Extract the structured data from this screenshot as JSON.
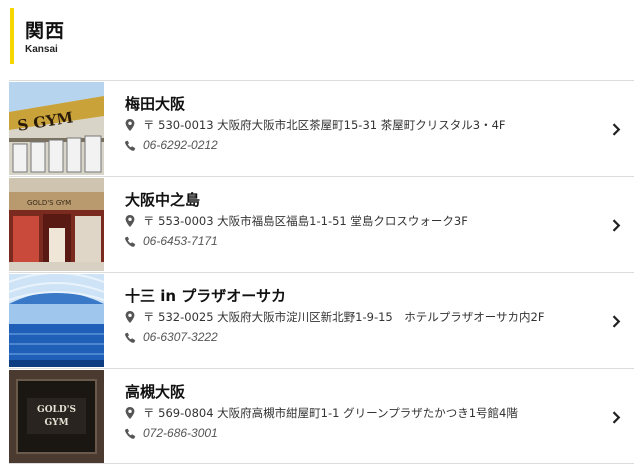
{
  "region": {
    "title": "関西",
    "subtitle": "Kansai",
    "accent_color": "#f5d800"
  },
  "icons": {
    "location": "location-pin-icon",
    "phone": "phone-icon",
    "chevron": "chevron-right-icon"
  },
  "gyms": [
    {
      "name": "梅田大阪",
      "address": "〒 530-0013 大阪府大阪市北区茶屋町15-31 茶屋町クリスタル3・4F",
      "phone": "06-6292-0212"
    },
    {
      "name": "大阪中之島",
      "address": "〒 553-0003 大阪市福島区福島1-1-51 堂島クロスウォーク3F",
      "phone": "06-6453-7171"
    },
    {
      "name": "十三 in プラザオーサカ",
      "address": "〒 532-0025 大阪府大阪市淀川区新北野1-9-15　ホテルプラザオーサカ内2F",
      "phone": "06-6307-3222"
    },
    {
      "name": "高槻大阪",
      "address": "〒 569-0804 大阪府高槻市紺屋町1-1 グリーンプラザたかつき1号館4階",
      "phone": "072-686-3001"
    }
  ]
}
